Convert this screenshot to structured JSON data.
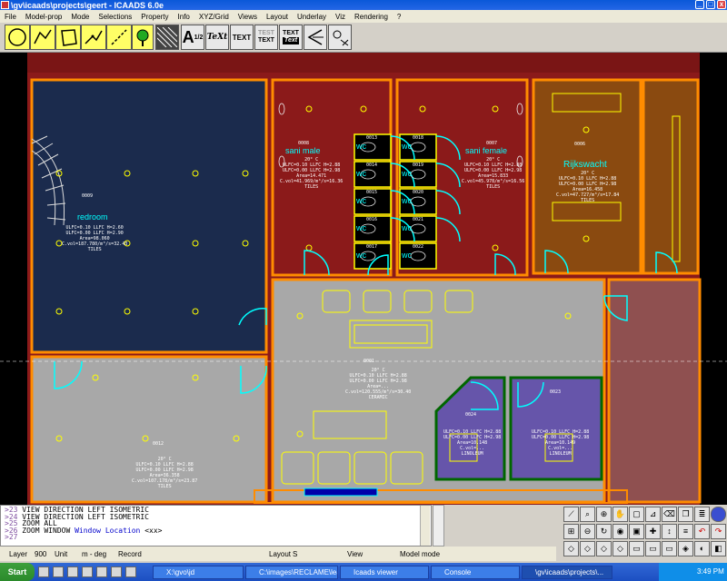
{
  "window": {
    "title": "\\gv\\icaads\\projects\\geert - ICAADS 6.0e"
  },
  "menu": [
    "File",
    "Model-prop",
    "Mode",
    "Selections",
    "Property",
    "Info",
    "XYZ/Grid",
    "Views",
    "Layout",
    "Underlay",
    "Viz",
    "Rendering",
    "?"
  ],
  "toolbar": {
    "tools": [
      {
        "name": "circle-tool-icon"
      },
      {
        "name": "polyline-tool-icon"
      },
      {
        "name": "polygon-tool-icon"
      },
      {
        "name": "arrow-line-tool-icon"
      },
      {
        "name": "dashed-line-tool-icon"
      },
      {
        "name": "tree-tool-icon"
      },
      {
        "name": "hatch-tool-icon"
      }
    ],
    "text_a": "A",
    "text_fraction": "1/2",
    "text_script": "TeXt",
    "text_plain": "TEXT",
    "text_stack_top": "TEST",
    "text_stack_bottom": "TEXT",
    "text_style_top": "TEXT",
    "text_style_bottom": "Text"
  },
  "rooms": {
    "bedroom": {
      "number": "0009",
      "name": "redroom",
      "info": [
        "20° C",
        "ULFC=0.10 LLFC H=2.60",
        "ULFC=0.00 LLFC H=2.90",
        "Area=98.060",
        "C.vol=187.780/m³/s=32.43",
        "TILES"
      ]
    },
    "sani_male": {
      "number": "0008",
      "name": "sani male",
      "info": [
        "20° C",
        "ULFC=0.10 LLFC H=2.88",
        "ULFC=0.00 LLFC H=2.98",
        "Area=14.471",
        "C.vol=41.969/m³/s=16.36",
        "TILES"
      ]
    },
    "sani_female": {
      "number": "0007",
      "name": "sani female",
      "info": [
        "20° C",
        "ULFC=0.10 LLFC H=2.88",
        "ULFC=0.00 LLFC H=2.98",
        "Area=15.833",
        "C.vol=45.978/m³/s=16.56",
        "TILES"
      ]
    },
    "wc": {
      "numbers": [
        "0013",
        "0014",
        "0015",
        "0016",
        "0017",
        "0018",
        "0019",
        "0020",
        "0021",
        "0022"
      ],
      "name": "wc"
    },
    "rijkswacht": {
      "number": "0006",
      "name": "Rijkswacht",
      "info": [
        "20° C",
        "ULFC=0.10 LLFC H=2.88",
        "ULFC=0.00 LLFC H=2.98",
        "Area=16.458",
        "C.vol=47.727/m³/s=17.84",
        "TILES"
      ]
    },
    "central": {
      "number": "0001",
      "name": "",
      "info": [
        "20° C",
        "ULFC=0.10 LLFC H=2.88",
        "ULFC=0.00 LLFC H=2.98",
        "Area=...",
        "C.vol=120.555/m³/s=30.40",
        "CERAMIC"
      ]
    },
    "lower_left": {
      "number": "0012",
      "name": "",
      "info": [
        "20° C",
        "ULFC=0.10 LLFC H=2.88",
        "ULFC=0.00 LLFC H=2.98",
        "Area=36.358",
        "C.vol=107.178/m³/s=23.87",
        "TILES"
      ]
    },
    "cell_a": {
      "number": "0024",
      "info": [
        "ULFC=0.10 LLFC H=2.88",
        "ULFC=0.00 LLFC H=2.98",
        "Area=10.148",
        "C.vol=...",
        "LINOLEUM"
      ]
    },
    "cell_b": {
      "number": "0023",
      "info": [
        "ULFC=0.10 LLFC H=2.88",
        "ULFC=0.00 LLFC H=2.98",
        "Area=10.149",
        "C.vol=...",
        "LINOLEUM"
      ]
    }
  },
  "console": {
    "lines": [
      {
        "no": ">23",
        "text": "VIEW DIRECTION LEFT ISOMETRIC"
      },
      {
        "no": ">24",
        "text": "VIEW DIRECTION LEFT ISOMETRIC"
      },
      {
        "no": ">25",
        "text": "ZOOM ALL"
      },
      {
        "no": ">26",
        "text": "ZOOM WINDOW"
      },
      {
        "no": ">27",
        "text": ""
      }
    ],
    "line26_window": "Window",
    "line26_location": "Location",
    "line26_xx": "<xx>"
  },
  "status": {
    "layer_label": "Layer",
    "layer_value": "900",
    "unit_label": "Unit",
    "unit_value": "m - deg",
    "record": "Record",
    "layout_label": "Layout",
    "layout_value": "S",
    "view": "View",
    "mode": "Model mode"
  },
  "taskbar": {
    "start": "Start",
    "apps": [
      {
        "label": "X:\\gvo\\jd",
        "active": false
      },
      {
        "label": "C:\\images\\RECLAME\\leaf...",
        "active": false
      },
      {
        "label": "Icaads viewer",
        "active": false
      },
      {
        "label": "Console",
        "active": false
      },
      {
        "label": "\\gv\\icaads\\projects\\...",
        "active": true
      }
    ],
    "clock": "3:49 PM"
  },
  "colors": {
    "canvas": "#000000",
    "wall": "#ff8c00",
    "dark_blue": "#1b2b4d",
    "red": "#8b1a1a",
    "brown": "#8a4a10",
    "gray_floor": "#a8a8a8",
    "violet": "#6655aa",
    "cyan": "#00ffff",
    "yellow": "#ffff00"
  }
}
